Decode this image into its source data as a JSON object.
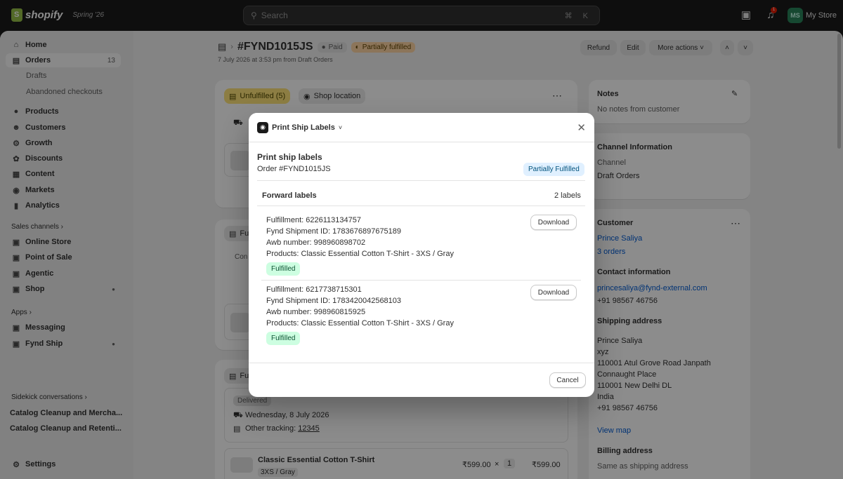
{
  "topbar": {
    "brand": "shopify",
    "season": "Spring '26",
    "search_placeholder": "Search",
    "search_shortcut": "⌘ K",
    "notification_count": "1",
    "store_initials": "MS",
    "store_name": "My Store"
  },
  "sidebar": {
    "items": [
      {
        "label": "Home",
        "icon": "home-icon"
      },
      {
        "label": "Orders",
        "icon": "orders-icon",
        "count": "13"
      },
      {
        "label": "Drafts"
      },
      {
        "label": "Abandoned checkouts"
      },
      {
        "label": "Products",
        "icon": "tag-icon"
      },
      {
        "label": "Customers",
        "icon": "person-icon"
      },
      {
        "label": "Growth",
        "icon": "growth-icon"
      },
      {
        "label": "Discounts",
        "icon": "discount-icon"
      },
      {
        "label": "Content",
        "icon": "content-icon"
      },
      {
        "label": "Markets",
        "icon": "globe-icon"
      },
      {
        "label": "Analytics",
        "icon": "chart-icon"
      }
    ],
    "sales_channels_label": "Sales channels",
    "channels": [
      {
        "label": "Online Store",
        "icon": "store-icon"
      },
      {
        "label": "Point of Sale",
        "icon": "pos-icon"
      },
      {
        "label": "Agentic",
        "icon": "agentic-icon"
      },
      {
        "label": "Shop",
        "icon": "shop-icon"
      }
    ],
    "apps_label": "Apps",
    "apps": [
      {
        "label": "Messaging",
        "icon": "messaging-icon"
      },
      {
        "label": "Fynd Ship",
        "icon": "fynd-icon"
      }
    ],
    "sidekick_label": "Sidekick conversations",
    "conversations": [
      "Catalog Cleanup and Mercha...",
      "Catalog Cleanup and Retenti..."
    ],
    "settings_label": "Settings"
  },
  "order": {
    "number": "#FYND1015JS",
    "payment_status": "Paid",
    "fulfillment_status": "Partially fulfilled",
    "subtitle": "7 July 2026 at 3:53 pm from Draft Orders",
    "actions": {
      "refund": "Refund",
      "edit": "Edit",
      "more": "More actions"
    }
  },
  "background": {
    "unfulfilled_chip": "Unfulfilled (5)",
    "shop_location": "Shop location",
    "fulfilled_prefix_1": "Fu",
    "fulfilled_prefix_2": "Fu",
    "con_prefix": "Con",
    "delivered": "Delivered",
    "delivered_date": "Wednesday, 8 July 2026",
    "other_tracking_label": "Other tracking:",
    "other_tracking_value": "12345",
    "product_name": "Classic Essential Cotton T-Shirt",
    "product_variant": "3XS / Gray",
    "product_price": "₹599.00",
    "product_times": "×",
    "product_qty": "1",
    "product_total": "₹599.00"
  },
  "right": {
    "notes_title": "Notes",
    "notes_text": "No notes from customer",
    "channel_title": "Channel Information",
    "channel_label": "Channel",
    "channel_value": "Draft Orders",
    "customer_title": "Customer",
    "customer_name": "Prince Saliya",
    "customer_orders": "3 orders",
    "contact_title": "Contact information",
    "email": "princesaliya@fynd-external.com",
    "phone": "+91 98567 46756",
    "shipping_title": "Shipping address",
    "shipping_lines": [
      "Prince Saliya",
      "xyz",
      "110001 Atul Grove Road Janpath",
      "Connaught Place",
      "110001 New Delhi DL",
      "India",
      "+91 98567 46756"
    ],
    "view_map": "View map",
    "billing_title": "Billing address",
    "billing_text": "Same as shipping address"
  },
  "modal": {
    "app_title": "Print Ship Labels",
    "heading": "Print ship labels",
    "order_line": "Order #FYND1015JS",
    "status_badge": "Partially Fulfilled",
    "forward_label": "Forward labels",
    "label_count": "2 labels",
    "download_label": "Download",
    "cancel_label": "Cancel",
    "fulfillments": [
      {
        "fulfillment": "Fulfillment: 6226113134757",
        "shipment": "Fynd Shipment ID: 1783676897675189",
        "awb": "Awb number: 998960898702",
        "products": "Products: Classic Essential Cotton T-Shirt - 3XS / Gray",
        "status": "Fulfilled"
      },
      {
        "fulfillment": "Fulfillment: 6217738715301",
        "shipment": "Fynd Shipment ID: 1783420042568103",
        "awb": "Awb number: 998960815925",
        "products": "Products: Classic Essential Cotton T-Shirt - 3XS / Gray",
        "status": "Fulfilled"
      }
    ]
  }
}
